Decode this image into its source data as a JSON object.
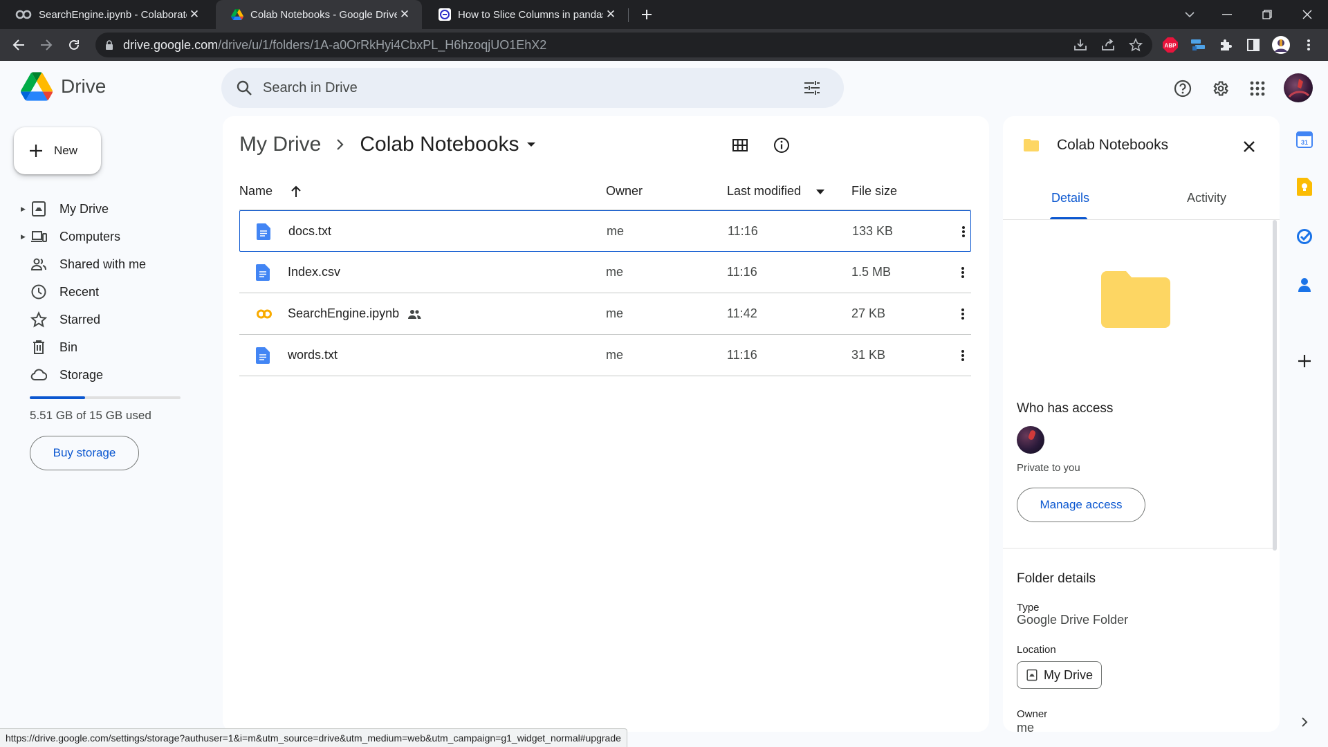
{
  "browser": {
    "tabs": [
      {
        "title": "SearchEngine.ipynb - Colaborato",
        "icon": "colab-icon",
        "active": false
      },
      {
        "title": "Colab Notebooks - Google Drive",
        "icon": "drive-icon",
        "active": true
      },
      {
        "title": "How to Slice Columns in pandas",
        "icon": "site-icon",
        "active": false
      }
    ],
    "url_host": "drive.google.com",
    "url_path": "/drive/u/1/folders/1A-a0OrRkHyi4CbxPL_H6hzoqjUO1EhX2",
    "extensions": [
      "download-icon",
      "share-icon",
      "star-icon",
      "adblock-icon",
      "translate-icon",
      "puzzle-icon",
      "sidepanel-icon",
      "profile-icon",
      "menu-icon"
    ],
    "adblock_label": "ABP"
  },
  "header": {
    "product_name": "Drive",
    "search_placeholder": "Search in Drive",
    "icons": [
      "help-icon",
      "settings-icon",
      "apps-icon",
      "account-avatar"
    ]
  },
  "sidebar": {
    "new_label": "New",
    "items": [
      {
        "label": "My Drive",
        "icon": "my-drive-icon",
        "expandable": true
      },
      {
        "label": "Computers",
        "icon": "computers-icon",
        "expandable": true
      },
      {
        "label": "Shared with me",
        "icon": "shared-icon",
        "expandable": false
      },
      {
        "label": "Recent",
        "icon": "clock-icon",
        "expandable": false
      },
      {
        "label": "Starred",
        "icon": "star-icon",
        "expandable": false
      },
      {
        "label": "Bin",
        "icon": "bin-icon",
        "expandable": false
      },
      {
        "label": "Storage",
        "icon": "cloud-icon",
        "expandable": false
      }
    ],
    "storage_used_fraction": 0.367,
    "storage_text": "5.51 GB of 15 GB used",
    "buy_storage_label": "Buy storage"
  },
  "main": {
    "breadcrumb_root": "My Drive",
    "breadcrumb_current": "Colab Notebooks",
    "columns": {
      "name": "Name",
      "owner": "Owner",
      "modified": "Last modified",
      "size": "File size"
    },
    "sort_column": "Last modified",
    "files": [
      {
        "name": "docs.txt",
        "type": "doc",
        "shared": false,
        "owner": "me",
        "modified": "11:16",
        "size": "133 KB",
        "selected": true
      },
      {
        "name": "Index.csv",
        "type": "doc",
        "shared": false,
        "owner": "me",
        "modified": "11:16",
        "size": "1.5 MB",
        "selected": false
      },
      {
        "name": "SearchEngine.ipynb",
        "type": "colab",
        "shared": true,
        "owner": "me",
        "modified": "11:42",
        "size": "27 KB",
        "selected": false
      },
      {
        "name": "words.txt",
        "type": "doc",
        "shared": false,
        "owner": "me",
        "modified": "11:16",
        "size": "31 KB",
        "selected": false
      }
    ]
  },
  "details": {
    "title": "Colab Notebooks",
    "tabs": [
      "Details",
      "Activity"
    ],
    "active_tab": "Details",
    "who_has_access": "Who has access",
    "private_text": "Private to you",
    "manage_access_label": "Manage access",
    "folder_details_heading": "Folder details",
    "type_label": "Type",
    "type_value": "Google Drive Folder",
    "location_label": "Location",
    "location_value": "My Drive",
    "owner_label": "Owner",
    "owner_value": "me"
  },
  "side_apps": [
    "calendar-icon",
    "keep-icon",
    "tasks-icon",
    "contacts-icon",
    "add-icon"
  ],
  "status_url": "https://drive.google.com/settings/storage?authuser=1&i=m&utm_source=drive&utm_medium=web&utm_campaign=g1_widget_normal#upgrade",
  "colors": {
    "accent": "#0b57d0",
    "folder": "#fdd663",
    "chrome_dark": "#202124"
  }
}
